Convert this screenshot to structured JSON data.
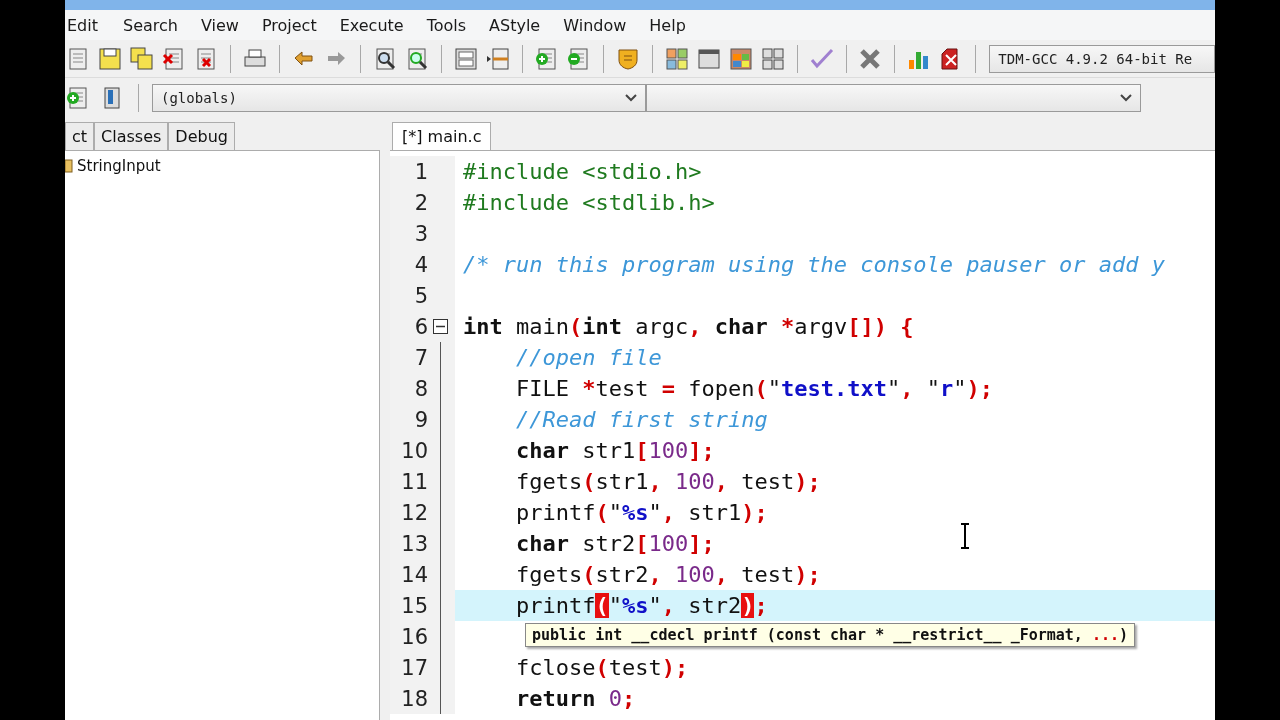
{
  "menu": [
    "Edit",
    "Search",
    "View",
    "Project",
    "Execute",
    "Tools",
    "AStyle",
    "Window",
    "Help"
  ],
  "compiler": {
    "value": "TDM-GCC 4.9.2 64-bit Re"
  },
  "scope": {
    "value": "(globals)"
  },
  "left_panel": {
    "tabs": [
      {
        "label": "ct",
        "selected": false
      },
      {
        "label": "Classes",
        "selected": false
      },
      {
        "label": "Debug",
        "selected": false
      }
    ],
    "tree": [
      {
        "label": "StringInput"
      }
    ]
  },
  "editor": {
    "tabs": [
      {
        "label": "[*] main.c",
        "selected": true
      }
    ],
    "lines": [
      {
        "n": "1",
        "fold": false,
        "current": false,
        "tokens": [
          {
            "kind": "pp",
            "text": "#include <stdio.h>"
          }
        ]
      },
      {
        "n": "2",
        "fold": false,
        "current": false,
        "tokens": [
          {
            "kind": "pp",
            "text": "#include <stdlib.h>"
          }
        ]
      },
      {
        "n": "3",
        "fold": false,
        "current": false
      },
      {
        "n": "4",
        "fold": false,
        "current": false,
        "tokens": [
          {
            "kind": "comment",
            "text": "/* run this program using the console pauser or add y"
          }
        ]
      },
      {
        "n": "5",
        "fold": false,
        "current": false
      },
      {
        "n": "6",
        "fold": true,
        "current": false,
        "tokens": [
          {
            "kind": "kw",
            "text": "int"
          },
          {
            "kind": "id",
            "text": " main"
          },
          {
            "kind": "punct",
            "text": "("
          },
          {
            "kind": "kw",
            "text": "int"
          },
          {
            "kind": "id",
            "text": " argc"
          },
          {
            "kind": "punct",
            "text": ","
          },
          {
            "kind": "kw",
            "text": " char"
          },
          {
            "kind": "punct",
            "text": " *"
          },
          {
            "kind": "id",
            "text": "argv"
          },
          {
            "kind": "punct",
            "text": "[])"
          },
          {
            "kind": "punct",
            "text": " {"
          }
        ]
      },
      {
        "n": "7",
        "fold": false,
        "current": false,
        "tokens": [
          {
            "kind": "comment",
            "text": "    //open file"
          }
        ]
      },
      {
        "n": "8",
        "fold": false,
        "current": false,
        "tokens": [
          {
            "kind": "id",
            "text": "    FILE "
          },
          {
            "kind": "punct",
            "text": "*"
          },
          {
            "kind": "id",
            "text": "test "
          },
          {
            "kind": "punct",
            "text": "="
          },
          {
            "kind": "id",
            "text": " fopen"
          },
          {
            "kind": "punct",
            "text": "("
          },
          {
            "kind": "id",
            "text": "\""
          },
          {
            "kind": "str",
            "text": "test.txt"
          },
          {
            "kind": "id",
            "text": "\""
          },
          {
            "kind": "punct",
            "text": ","
          },
          {
            "kind": "id",
            "text": " \""
          },
          {
            "kind": "str",
            "text": "r"
          },
          {
            "kind": "id",
            "text": "\""
          },
          {
            "kind": "punct",
            "text": ");"
          }
        ]
      },
      {
        "n": "9",
        "fold": false,
        "current": false,
        "tokens": [
          {
            "kind": "comment",
            "text": "    //Read first string"
          }
        ]
      },
      {
        "n": "10",
        "fold": false,
        "current": false,
        "tokens": [
          {
            "kind": "kw",
            "text": "    char"
          },
          {
            "kind": "id",
            "text": " str1"
          },
          {
            "kind": "punct",
            "text": "["
          },
          {
            "kind": "num",
            "text": "100"
          },
          {
            "kind": "punct",
            "text": "];"
          }
        ]
      },
      {
        "n": "11",
        "fold": false,
        "current": false,
        "tokens": [
          {
            "kind": "id",
            "text": "    fgets"
          },
          {
            "kind": "punct",
            "text": "("
          },
          {
            "kind": "id",
            "text": "str1"
          },
          {
            "kind": "punct",
            "text": ","
          },
          {
            "kind": "num",
            "text": " 100"
          },
          {
            "kind": "punct",
            "text": ","
          },
          {
            "kind": "id",
            "text": " test"
          },
          {
            "kind": "punct",
            "text": ");"
          }
        ]
      },
      {
        "n": "12",
        "fold": false,
        "current": false,
        "tokens": [
          {
            "kind": "id",
            "text": "    printf"
          },
          {
            "kind": "punct",
            "text": "("
          },
          {
            "kind": "id",
            "text": "\""
          },
          {
            "kind": "str",
            "text": "%s"
          },
          {
            "kind": "id",
            "text": "\""
          },
          {
            "kind": "punct",
            "text": ","
          },
          {
            "kind": "id",
            "text": " str1"
          },
          {
            "kind": "punct",
            "text": ");"
          }
        ]
      },
      {
        "n": "13",
        "fold": false,
        "current": false,
        "tokens": [
          {
            "kind": "kw",
            "text": "    char"
          },
          {
            "kind": "id",
            "text": " str2"
          },
          {
            "kind": "punct",
            "text": "["
          },
          {
            "kind": "num",
            "text": "100"
          },
          {
            "kind": "punct",
            "text": "];"
          }
        ]
      },
      {
        "n": "14",
        "fold": false,
        "current": false,
        "tokens": [
          {
            "kind": "id",
            "text": "    fgets"
          },
          {
            "kind": "punct",
            "text": "("
          },
          {
            "kind": "id",
            "text": "str2"
          },
          {
            "kind": "punct",
            "text": ","
          },
          {
            "kind": "num",
            "text": " 100"
          },
          {
            "kind": "punct",
            "text": ","
          },
          {
            "kind": "id",
            "text": " test"
          },
          {
            "kind": "punct",
            "text": ");"
          }
        ]
      },
      {
        "n": "15",
        "fold": false,
        "current": true,
        "tokens": [
          {
            "kind": "id",
            "text": "    printf"
          },
          {
            "kind": "match",
            "text": "("
          },
          {
            "kind": "id",
            "text": "\""
          },
          {
            "kind": "str",
            "text": "%s"
          },
          {
            "kind": "id",
            "text": "\""
          },
          {
            "kind": "punct",
            "text": ","
          },
          {
            "kind": "id",
            "text": " str2"
          },
          {
            "kind": "match",
            "text": ")"
          },
          {
            "kind": "punct",
            "text": ";"
          }
        ]
      },
      {
        "n": "16",
        "fold": false,
        "current": false
      },
      {
        "n": "17",
        "fold": false,
        "current": false,
        "tokens": [
          {
            "kind": "id",
            "text": "    fclose"
          },
          {
            "kind": "punct",
            "text": "("
          },
          {
            "kind": "id",
            "text": "test"
          },
          {
            "kind": "punct",
            "text": ");"
          }
        ]
      },
      {
        "n": "18",
        "fold": false,
        "current": false,
        "tokens": [
          {
            "kind": "kw",
            "text": "    return"
          },
          {
            "kind": "num",
            "text": " 0"
          },
          {
            "kind": "punct",
            "text": ";"
          }
        ]
      }
    ],
    "tooltip": {
      "parts": [
        {
          "kind": "plain",
          "text": "public int __cdecl printf (const char * __restrict__ _Format, "
        },
        {
          "kind": "accent",
          "text": "..."
        },
        {
          "kind": "plain",
          "text": ")"
        }
      ]
    }
  }
}
